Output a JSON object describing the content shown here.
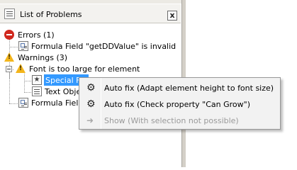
{
  "panel": {
    "title": "List of Problems",
    "close_label": "x"
  },
  "tree": {
    "errors_group": "Errors (1)",
    "error_item": "Formula Field \"getDDValue\" is invalid",
    "warnings_group": "Warnings (3)",
    "font_warning": "Font is too large for element",
    "special_field": "Special Fie",
    "text_object": "Text Obje",
    "formula_field": "Formula Field"
  },
  "context_menu": {
    "items": [
      {
        "label": "Auto fix (Adapt element height to font size)",
        "icon": "gear-icon",
        "enabled": true
      },
      {
        "label": "Auto fix (Check property \"Can Grow\")",
        "icon": "gear-icon",
        "enabled": true
      },
      {
        "label": "Show (With selection not possible)",
        "icon": "arrow-right-icon",
        "enabled": false
      }
    ]
  },
  "colors": {
    "selection": "#3399ff",
    "error": "#d0281e",
    "warning": "#f3b51c"
  }
}
